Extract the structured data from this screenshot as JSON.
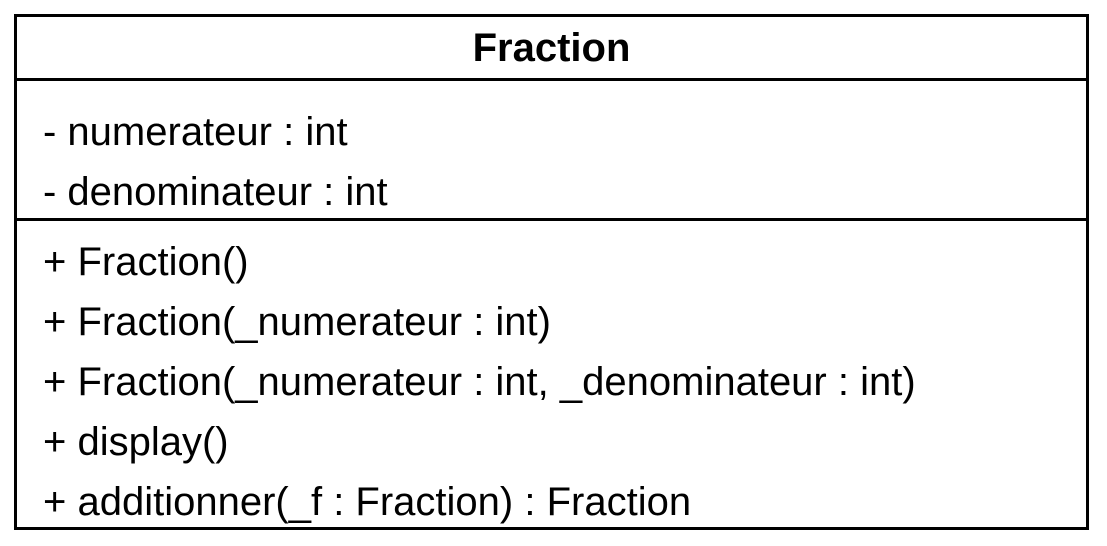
{
  "class_name": "Fraction",
  "attributes": [
    "- numerateur : int",
    "- denominateur : int"
  ],
  "operations": [
    "+ Fraction()",
    "+ Fraction(_numerateur : int)",
    "+ Fraction(_numerateur : int, _denominateur : int)",
    "+ display()",
    "+ additionner(_f : Fraction) : Fraction"
  ]
}
